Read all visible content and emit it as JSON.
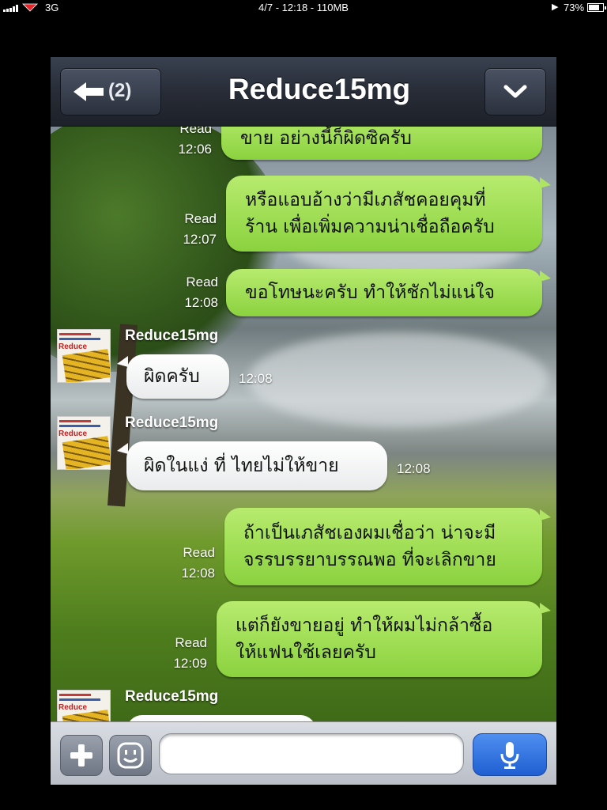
{
  "status_bar": {
    "network": "3G",
    "center_text": "4/7 - 12:18 - 110MB",
    "battery": "73%",
    "icons": [
      "signal-icon",
      "carrier-icon",
      "play-icon",
      "battery-icon"
    ]
  },
  "header": {
    "back_count": "(2)",
    "title": "Reduce15mg",
    "back_icon": "back-arrow-icon",
    "menu_icon": "chevron-down-icon"
  },
  "messages": [
    {
      "direction": "out",
      "lines": [
        "ขาย อย่างนี้ก็ผิดซิครับ"
      ],
      "status": "Read",
      "time": "12:06"
    },
    {
      "direction": "out",
      "lines": [
        "หรือแอบอ้างว่ามีเภสัชคอยคุมที่",
        "ร้าน เพื่อเพิ่มความน่าเชื่อถือครับ"
      ],
      "status": "Read",
      "time": "12:07"
    },
    {
      "direction": "out",
      "lines": [
        "ขอโทษนะครับ ทำให้ชักไม่แน่ใจ"
      ],
      "status": "Read",
      "time": "12:08"
    },
    {
      "direction": "in",
      "sender": "Reduce15mg",
      "lines": [
        "ผิดครับ"
      ],
      "time": "12:08"
    },
    {
      "direction": "in",
      "sender": "Reduce15mg",
      "lines": [
        "ผิดในแง่ ที่ ไทยไม่ให้ขาย"
      ],
      "time": "12:08"
    },
    {
      "direction": "out",
      "lines": [
        "ถ้าเป็นเภสัชเองผมเชื่อว่า น่าจะมี",
        "จรรบรรยาบรรณพอ ที่จะเลิกขาย"
      ],
      "status": "Read",
      "time": "12:08"
    },
    {
      "direction": "out",
      "lines": [
        "แต่ก็ยังขายอยู่ ทำให้ผมไม่กล้าซื้อ",
        "ให้แฟนใช้เลยครับ"
      ],
      "status": "Read",
      "time": "12:09"
    },
    {
      "direction": "in",
      "sender": "Reduce15mg",
      "lines": [
        ""
      ],
      "time": ""
    }
  ],
  "avatar_text": "Reduce",
  "input_bar": {
    "text_value": "",
    "icons": [
      "plus-icon",
      "smiley-icon",
      "microphone-icon"
    ]
  },
  "colors": {
    "outgoing_bubble": "#9edb52",
    "incoming_bubble": "#ffffff",
    "navbar": "#262b35",
    "mic_button": "#2f6fe0"
  }
}
